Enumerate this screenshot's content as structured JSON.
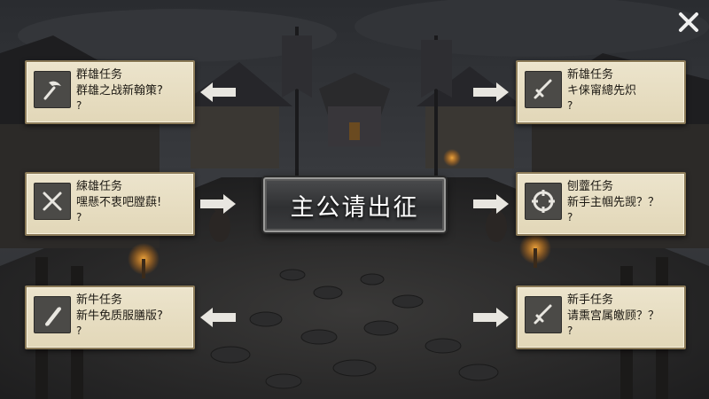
{
  "center_button": {
    "label": "主公请出征"
  },
  "close": {
    "icon": "close-icon"
  },
  "quests": [
    {
      "title": "群雄任务",
      "line1": "群雄之战新翰策?",
      "line2": "?",
      "icon": "pickaxe-icon"
    },
    {
      "title": "新雄任务",
      "line1": "キ俫甯總先炽",
      "line2": "?",
      "icon": "sword-icon"
    },
    {
      "title": "綀雄任务",
      "line1": "嘿懸不衷吧膛蕻!",
      "line2": "?",
      "icon": "crossed-swords-icon"
    },
    {
      "title": "刨虀任务",
      "line1": "新手主帼先觊？？",
      "line2": "?",
      "icon": "target-icon"
    },
    {
      "title": "新牛任务",
      "line1": "新牛免质服膳版?",
      "line2": "?",
      "icon": "scroll-icon"
    },
    {
      "title": "新手任务",
      "line1": "请熏宫属皦顾？？",
      "line2": "?",
      "icon": "sword-icon"
    }
  ],
  "colors": {
    "card_bg": "#e6dcc0",
    "card_border": "#8c7b58",
    "icon_bg": "#4b4a47",
    "button_text": "#ffffff"
  }
}
